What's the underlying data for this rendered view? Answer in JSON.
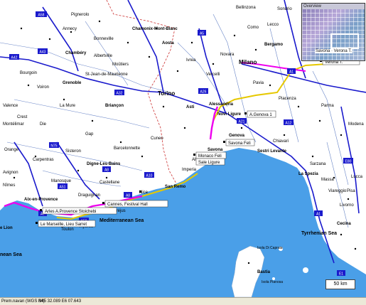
{
  "map": {
    "water_color": "#4a9fe8",
    "land_color": "#ffffff",
    "major_road_color": "#1a1acc",
    "route_color": "#ee00ee",
    "track_color": "#e6c800",
    "border_color": "#cc3333",
    "labels": {
      "pignerolo": "Pignerolo",
      "chamonix": "Chamonix-Mont-Blanc",
      "aosta": "Aosta",
      "bellinzona": "Bellinzona",
      "sondrio": "Sondrio",
      "bergamo": "Bergamo",
      "chambery": "Chambéry",
      "milano": "Milano",
      "verona": "Verona T.",
      "grenoble": "Grenoble",
      "torino": "Torino",
      "briancon": "Briançon",
      "asti": "Asti",
      "alessandria": "Alessandria",
      "novi_ligure": "Novi Ligure",
      "a_genova": "A.Genova 1",
      "genova": "Genova",
      "savona": "Savona",
      "savona_feli": "Savona Feli",
      "monaco_feli": "Monaco Feli",
      "sale_ligure": "Sale Ligure",
      "sestri_levante": "Sestri Levante",
      "la_spezia": "La Spezia",
      "digne": "Digne-Les-Bains",
      "san_remo": "San Remo",
      "cannes": "Cannes, Festival Hall",
      "aix": "Aix-en-Provence",
      "arles_provence": "Arles A.Provence Stoichebi",
      "marseille": "Le Marseille, Lieu Sarret",
      "lion": "e Lion",
      "mediterranean": "Mediterranean Sea",
      "tyrrhenian": "Tyrrhenian Sea",
      "nean_sea": "nean Sea",
      "bastia": "Bastia",
      "isola_capraia": "Isola Di Capraia",
      "isola_pianosa": "Isola Pianosa",
      "cecina": "Cecina",
      "livorno": "Livorno",
      "pisa": "Pisa",
      "modena": "Modena",
      "montelimar": "Montélimar",
      "valence": "Valence",
      "orange": "Orange",
      "avignon": "Avignon",
      "nimes": "Nîmes",
      "carpentras": "Carpentras",
      "manosque": "Manosque",
      "gap": "Gap",
      "cuneo": "Cuneo",
      "ivrea": "Ivrea",
      "vercelli": "Vercelli",
      "novara": "Novara",
      "pavia": "Pavia",
      "piacenza": "Piacenza",
      "parma": "Parma",
      "lecco": "Lecco",
      "como": "Como",
      "albertville": "Albertville",
      "annecy": "Annecy",
      "geneva_region": "Bonneville",
      "moutiers": "Moûtiers",
      "saint_jean": "St-Jean-de-Maurienne",
      "crest": "Crest",
      "die": "Die",
      "sisteron": "Sisteron",
      "bourgoin": "Bourgoin",
      "voiron": "Voiron",
      "la_mure": "La Mure",
      "barcelonnette": "Barcelonnette",
      "castellane": "Castellane",
      "draguignan": "Draguignan",
      "toulon": "Toulon",
      "hyeres": "Hyères",
      "frejus": "Fréjus",
      "nice": "Nice",
      "imperia": "Imperia",
      "albenga": "Albenga",
      "chiavari": "Chiavari",
      "sarzana": "Sarzana",
      "massa": "Massa",
      "viareggio": "Viareggio",
      "lucca": "Lucca"
    },
    "road_shields": [
      "A58",
      "A42",
      "A43",
      "A32",
      "A5",
      "A26",
      "A21",
      "A1",
      "A10",
      "A8",
      "A12",
      "A7",
      "A51",
      "N75",
      "A8",
      "A50",
      "E80",
      "A1",
      "E1"
    ]
  },
  "overview": {
    "title": "Overview",
    "label": "Savona · Verona T."
  },
  "scale": {
    "text": "50 km"
  },
  "statusbar": {
    "left": "Prem.navan (WGS 84)",
    "coords": "N45 32.089 E6 07.643"
  }
}
